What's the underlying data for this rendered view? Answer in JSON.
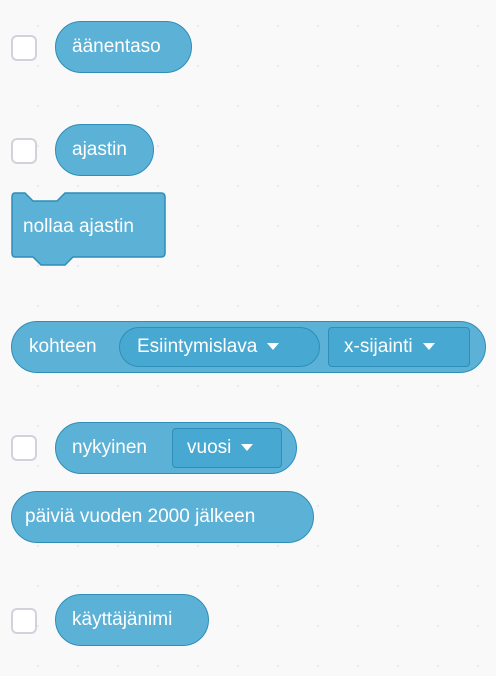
{
  "blocks": {
    "volume": {
      "label": "äänentaso"
    },
    "timer": {
      "label": "ajastin"
    },
    "reset_timer": {
      "label": "nollaa ajastin"
    },
    "of_block": {
      "label": "kohteen",
      "target_value": "Esiintymislava",
      "property_value": "x-sijainti"
    },
    "current": {
      "label": "nykyinen",
      "unit_value": "vuosi"
    },
    "days_since": {
      "label": "päiviä vuoden 2000 jälkeen"
    },
    "username": {
      "label": "käyttäjänimi"
    }
  },
  "colors": {
    "block_fill": "#5cb1d6",
    "block_border": "#2e8eb8",
    "dropdown_fill": "#47a8d1",
    "text": "#ffffff",
    "checkbox_border": "#d0d4da",
    "background": "#f9f9f9"
  }
}
